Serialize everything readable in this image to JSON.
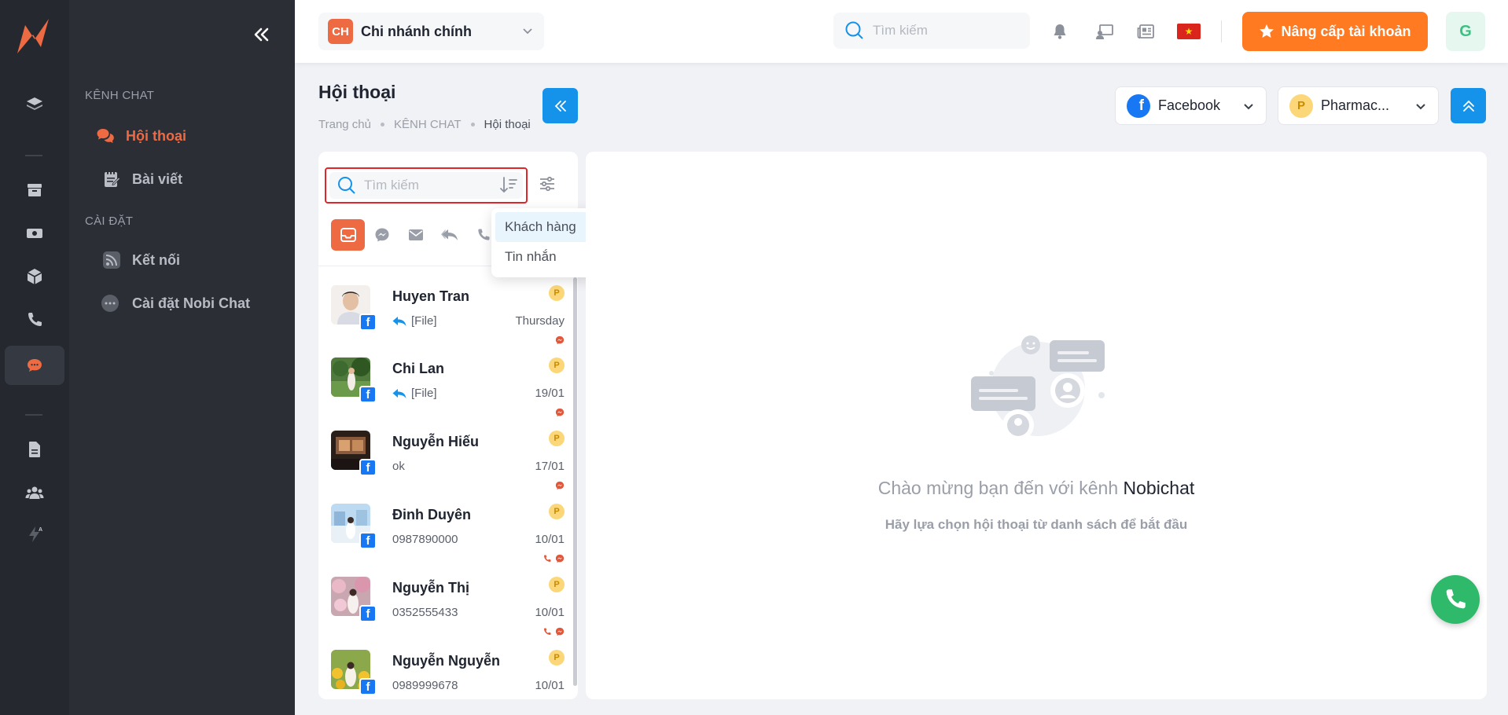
{
  "sidebar": {
    "collapse_icon": "double-chevron-left-icon",
    "sections": [
      {
        "title": "KÊNH CHAT",
        "items": [
          {
            "label": "Hội thoại",
            "icon": "chat-bubbles-icon",
            "active": true
          },
          {
            "label": "Bài viết",
            "icon": "notes-icon",
            "active": false
          }
        ]
      },
      {
        "title": "CÀI ĐẶT",
        "items": [
          {
            "label": "Kết nối",
            "icon": "rss-icon",
            "active": false
          },
          {
            "label": "Cài đặt Nobi Chat",
            "icon": "ellipsis-icon",
            "active": false
          }
        ]
      }
    ]
  },
  "header": {
    "branch_badge": "CH",
    "branch_name": "Chi nhánh chính",
    "search_placeholder": "Tìm kiếm",
    "upgrade_label": "Nâng cấp tài khoản",
    "user_initial": "G",
    "flag_star": "★"
  },
  "page": {
    "title": "Hội thoại",
    "breadcrumb": [
      "Trang chủ",
      "KÊNH CHAT",
      "Hội thoại"
    ],
    "channel_select": {
      "letter": "f",
      "label": "Facebook"
    },
    "page_select": {
      "letter": "P",
      "label": "Pharmac..."
    }
  },
  "list": {
    "search_placeholder": "Tìm kiếm",
    "conversations": [
      {
        "name": "Huyen Tran",
        "preview": "[File]",
        "reply": true,
        "date": "Thursday",
        "badge": "P",
        "call": false
      },
      {
        "name": "Chi Lan",
        "preview": "[File]",
        "reply": true,
        "date": "19/01",
        "badge": "P",
        "call": false
      },
      {
        "name": "Nguyễn Hiếu",
        "preview": "ok",
        "reply": false,
        "date": "17/01",
        "badge": "P",
        "call": false
      },
      {
        "name": "Đinh Duyên",
        "preview": "0987890000",
        "reply": false,
        "date": "10/01",
        "badge": "P",
        "call": true
      },
      {
        "name": "Nguyễn Thị",
        "preview": "0352555433",
        "reply": false,
        "date": "10/01",
        "badge": "P",
        "call": true
      },
      {
        "name": "Nguyễn Nguyễn",
        "preview": "0989999678",
        "reply": false,
        "date": "10/01",
        "badge": "P",
        "call": false
      }
    ],
    "fb_letter": "f"
  },
  "dropdown": {
    "options": [
      "Khách hàng",
      "Tin nhắn"
    ]
  },
  "chat": {
    "welcome_prefix": "Chào mừng bạn đến với kênh ",
    "welcome_brand": "Nobichat",
    "subtitle": "Hãy lựa chọn hội thoại từ danh sách để bắt đầu"
  },
  "colors": {
    "accent": "#ee6a43",
    "primary": "#1592ea",
    "upgrade": "#ff7a21",
    "facebook": "#1877f2",
    "call": "#2fb96a"
  }
}
